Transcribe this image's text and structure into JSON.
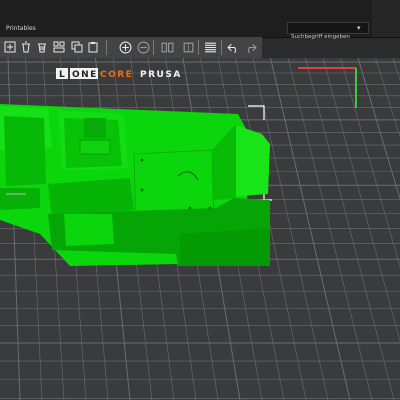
{
  "app": {
    "tab_label": "Printables",
    "search_placeholder": "Suchbegriff eingeben",
    "search_dropdown_icon": "chevron-down-icon"
  },
  "toolbar": {
    "tools": [
      {
        "name": "add-icon"
      },
      {
        "name": "delete-icon"
      },
      {
        "name": "delete-all-icon"
      },
      {
        "name": "arrange-icon"
      },
      {
        "name": "copy-icon"
      },
      {
        "name": "paste-icon"
      },
      {
        "name": "add-instance-icon"
      },
      {
        "name": "remove-instance-icon"
      },
      {
        "name": "split-objects-icon"
      },
      {
        "name": "split-parts-icon"
      },
      {
        "name": "variable-layer-height-icon"
      },
      {
        "name": "undo-icon"
      },
      {
        "name": "redo-icon"
      }
    ]
  },
  "bed": {
    "logo_prusa": "PRUSA",
    "logo_core": "CORE",
    "logo_one": "ONE",
    "logo_l": "L"
  },
  "colors": {
    "model": "#0bd60b",
    "model_dark": "#06b406",
    "model_shadow": "#049004",
    "accent": "#f06a0c",
    "bed": "#3a3b3c",
    "grid": "#6c6d6e"
  }
}
